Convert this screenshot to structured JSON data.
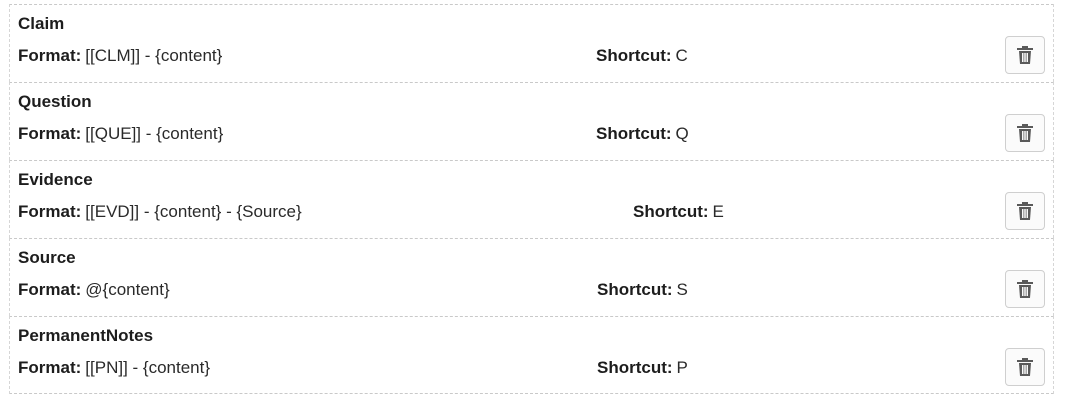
{
  "labels": {
    "format": "Format:",
    "shortcut": "Shortcut:"
  },
  "icon": "trash-icon",
  "rows": [
    {
      "title": "Claim",
      "format": "[[CLM]] - {content}",
      "shortcut": "C"
    },
    {
      "title": "Question",
      "format": "[[QUE]] - {content}",
      "shortcut": "Q"
    },
    {
      "title": "Evidence",
      "format": "[[EVD]] - {content} - {Source}",
      "shortcut": "E"
    },
    {
      "title": "Source",
      "format": "@{content}",
      "shortcut": "S"
    },
    {
      "title": "PermanentNotes",
      "format": "[[PN]] - {content}",
      "shortcut": "P"
    }
  ]
}
